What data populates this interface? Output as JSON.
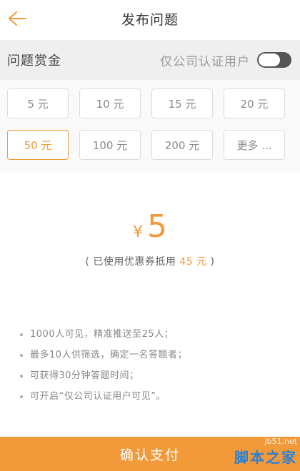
{
  "header": {
    "title": "发布问题",
    "back_icon": "arrow-left-icon"
  },
  "reward": {
    "label": "问题赏金",
    "toggle_label": "仅公司认证用户",
    "toggle_on": false
  },
  "amounts": [
    {
      "label": "5 元",
      "selected": false
    },
    {
      "label": "10 元",
      "selected": false
    },
    {
      "label": "15 元",
      "selected": false
    },
    {
      "label": "20 元",
      "selected": false
    },
    {
      "label": "50 元",
      "selected": true
    },
    {
      "label": "100 元",
      "selected": false
    },
    {
      "label": "200 元",
      "selected": false
    },
    {
      "label": "更多 ...",
      "selected": false
    }
  ],
  "display": {
    "currency": "¥",
    "amount": "5",
    "coupon_prefix": "( 已使用优惠券抵用 ",
    "coupon_value": "45 元",
    "coupon_suffix": " )"
  },
  "info": [
    "1000人可见，精准推送至25人；",
    "最多10人供筛选，确定一名答题者；",
    "可获得30分钟答题时间；",
    "可开启“仅公司认证用户可见”。"
  ],
  "confirm_label": "确认支付",
  "watermark": {
    "site": "jb51.net",
    "brand": "脚本之家"
  },
  "colors": {
    "accent": "#f29a3a",
    "toggle_off": "#555555"
  }
}
